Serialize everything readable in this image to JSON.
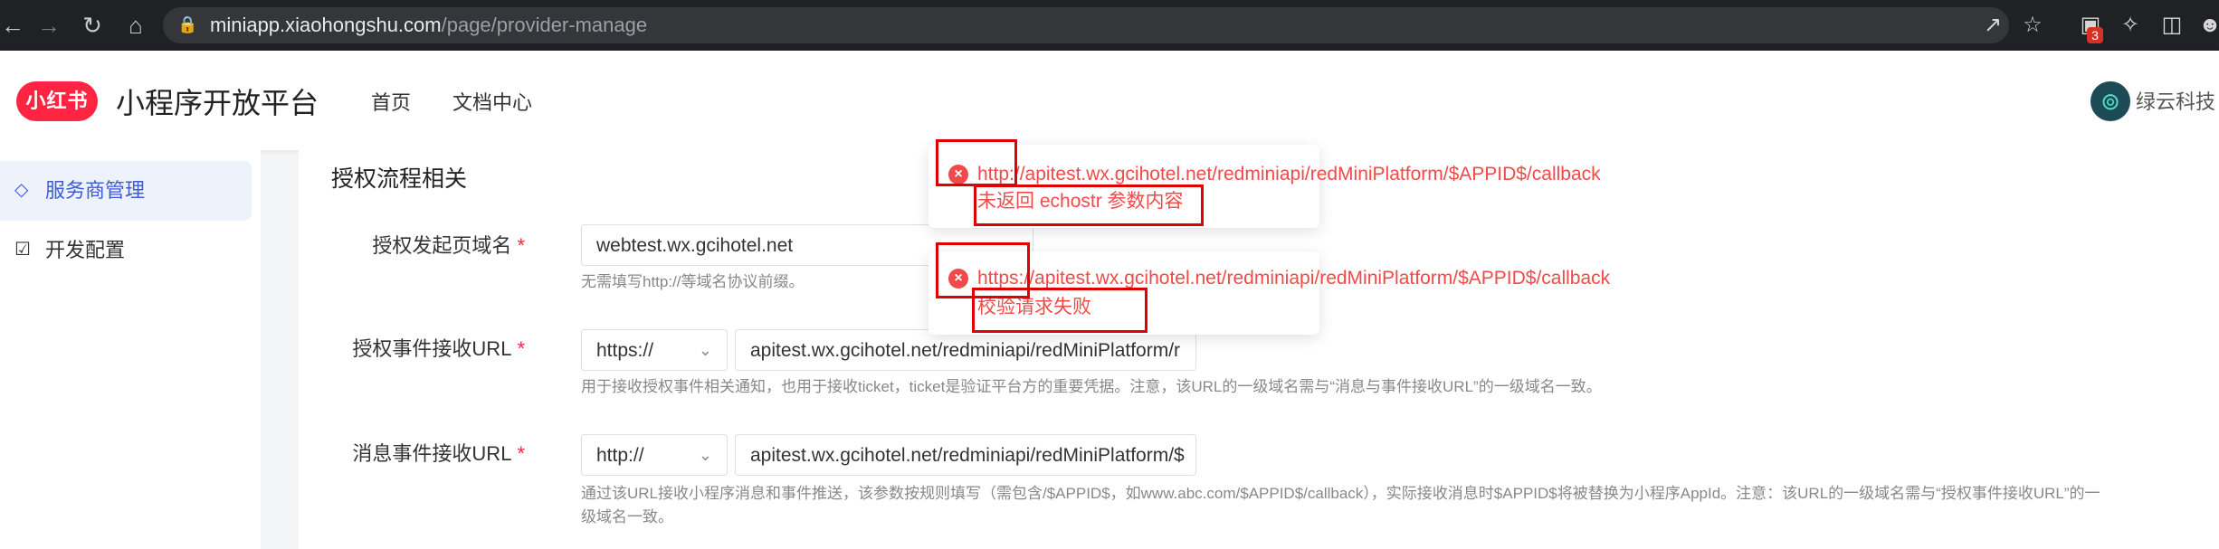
{
  "browser": {
    "url_host": "miniapp.xiaohongshu.com",
    "url_path": "/page/provider-manage",
    "extension_badge": "3"
  },
  "header": {
    "logo_text": "小红书",
    "app_title": "小程序开放平台",
    "nav": [
      "首页",
      "文档中心"
    ],
    "user_name": "绿云科技"
  },
  "sidebar": {
    "items": [
      {
        "label": "服务商管理",
        "icon": "tag-icon",
        "active": true
      },
      {
        "label": "开发配置",
        "icon": "clipboard-check-icon",
        "active": false
      }
    ]
  },
  "main": {
    "section_title": "授权流程相关",
    "fields": [
      {
        "label": "授权发起页域名",
        "value": "webtest.wx.gcihotel.net",
        "help": "无需填写http://等域名协议前缀。"
      },
      {
        "label": "授权事件接收URL",
        "protocol": "https://",
        "value": "apitest.wx.gcihotel.net/redminiapi/redMiniPlatform/r",
        "help": "用于接收授权事件相关通知，也用于接收ticket，ticket是验证平台方的重要凭据。注意，该URL的一级域名需与“消息与事件接收URL”的一级域名一致。"
      },
      {
        "label": "消息事件接收URL",
        "protocol": "http://",
        "value": "apitest.wx.gcihotel.net/redminiapi/redMiniPlatform/$",
        "help_line1": "通过该URL接收小程序消息和事件推送，该参数按规则填写（需包含/$APPID$，如www.abc.com/$APPID$/callback），实际接收消息时$APPID$将被替换为小程序AppId。注意：该URL的一级域名需与“授权事件接收URL”的一",
        "help_line2": "级域名一致。"
      }
    ]
  },
  "toasts": [
    {
      "url": "http://apitest.wx.gcihotel.net/redminiapi/redMiniPlatform/$APPID$/callback",
      "message": "未返回 echostr 参数内容"
    },
    {
      "url": "https://apitest.wx.gcihotel.net/redminiapi/redMiniPlatform/$APPID$/callback",
      "message": "校验请求失败"
    }
  ],
  "colors": {
    "brand": "#ff2442",
    "active_nav": "#3d5bd9",
    "error": "#f04a4a",
    "highlight_box": "#e00000"
  }
}
